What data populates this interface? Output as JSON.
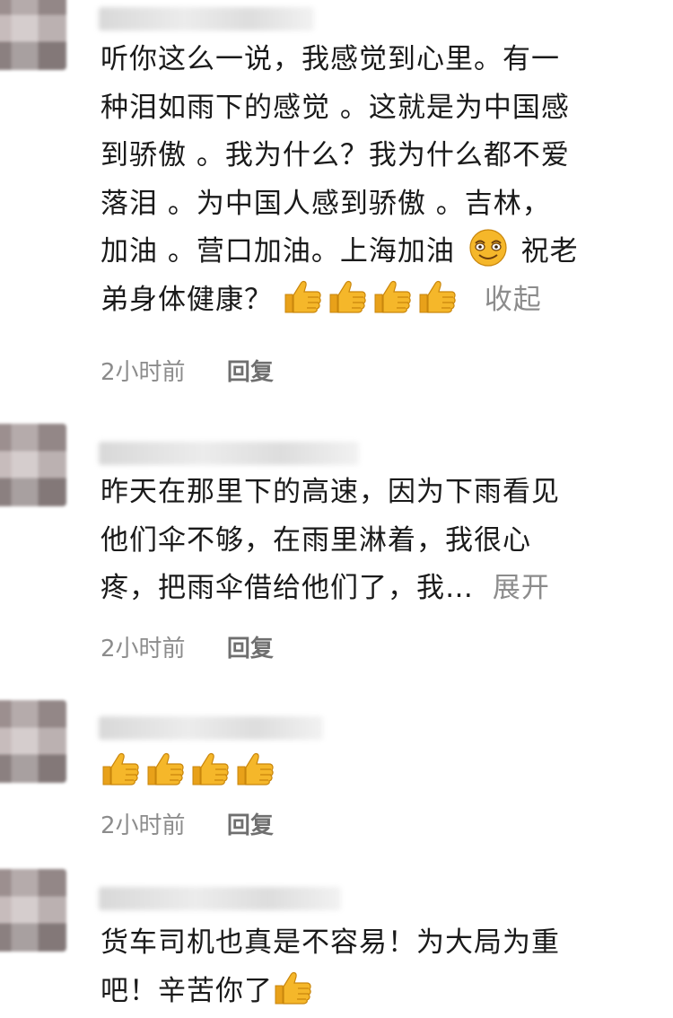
{
  "comments": [
    {
      "lines": [
        "听你这么一说，我感觉到心里。有一",
        "种泪如雨下的感觉 。这就是为中国感",
        "到骄傲 。我为什么？我为什么都不爱",
        "落泪 。为中国人感到骄傲 。吉林，"
      ],
      "line5_text": "加油 。营口加油。上海加油",
      "line5_after": "祝老",
      "line6_text": "弟身体健康？",
      "toggle": "收起",
      "time": "2小时前",
      "reply": "回复",
      "emoji_icons": [
        "smile-emoji",
        "thumbs-up-emoji"
      ]
    },
    {
      "lines": [
        "昨天在那里下的高速，因为下雨看见",
        "他们伞不够，在雨里淋着，我很心"
      ],
      "line3_text": "疼，把雨伞借给他们了，我…",
      "toggle": "展开",
      "time": "2小时前",
      "reply": "回复"
    },
    {
      "time": "2小时前",
      "reply": "回复",
      "emoji_icons": [
        "thumbs-up-emoji"
      ]
    },
    {
      "lines": [
        "货车司机也真是不容易！为大局为重"
      ],
      "line2_text": "吧！辛苦你了"
    }
  ],
  "colors": {
    "text": "#1a1a1a",
    "muted": "#8c8c8c",
    "emoji_yellow": "#f5b72a"
  }
}
